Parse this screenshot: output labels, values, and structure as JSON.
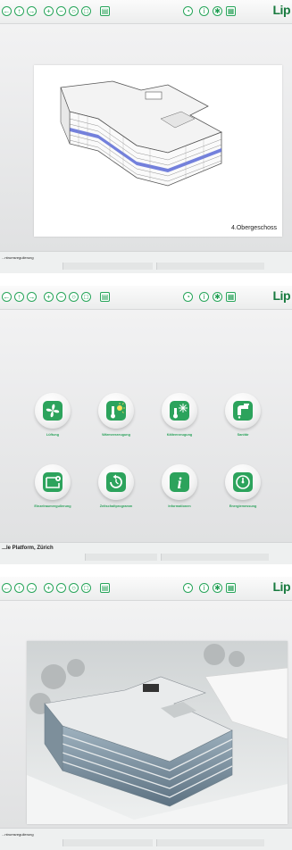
{
  "brand": {
    "name": "Lip"
  },
  "panels": [
    {
      "id": "overview",
      "floor_label": "4.Obergeschoss",
      "status": "...ntrumsregulierung"
    },
    {
      "id": "menu",
      "status": "...le Platform, Zürich",
      "tiles": [
        {
          "label": "Lüftung",
          "icon": "fan-icon"
        },
        {
          "label": "Wärmeerzeugung",
          "icon": "heater-icon"
        },
        {
          "label": "Kälteerzeugung",
          "icon": "snowflake-icon"
        },
        {
          "label": "Sanitär",
          "icon": "faucet-icon"
        },
        {
          "label": "Einzelraumregulierung",
          "icon": "room-control-icon"
        },
        {
          "label": "Zeitschaltprogramm",
          "icon": "clock-icon"
        },
        {
          "label": "Informationen",
          "icon": "info-icon"
        },
        {
          "label": "Energiemessung",
          "icon": "meter-icon"
        }
      ]
    },
    {
      "id": "rendering",
      "status": "...ntrumsregulierung"
    }
  ],
  "colors": {
    "accent": "#2ca35c",
    "brand": "#187a3f",
    "panel": "#e6e7e8"
  }
}
